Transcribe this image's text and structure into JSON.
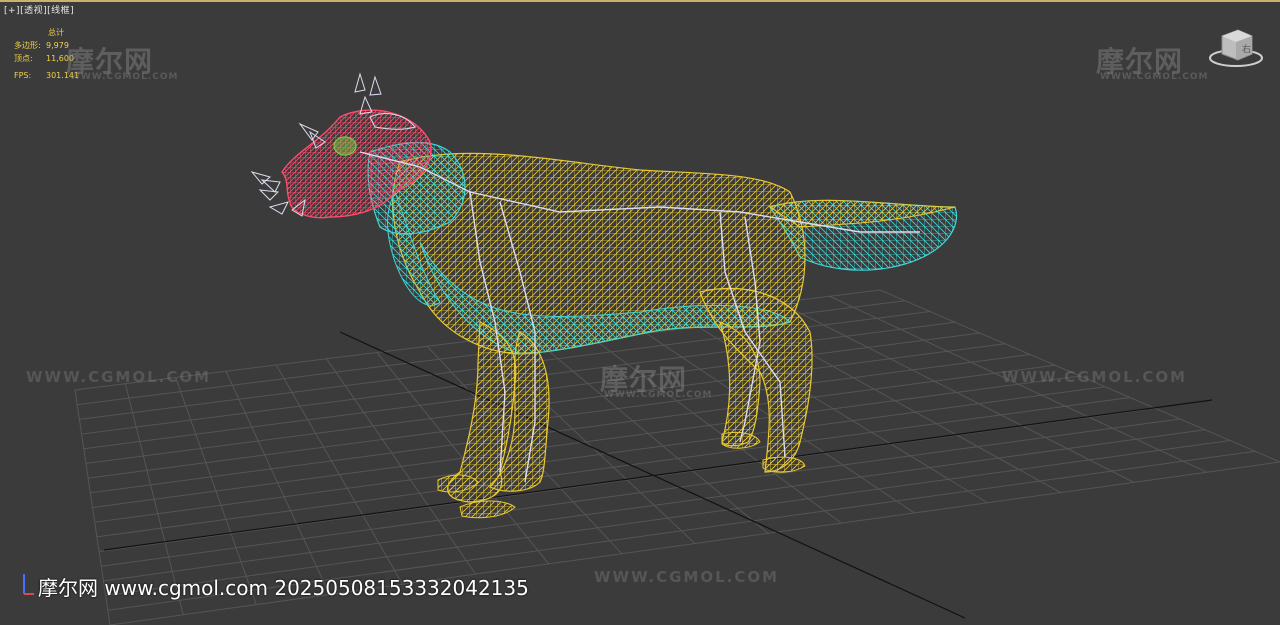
{
  "viewport": {
    "label_plus": "[+]",
    "label_view": "[透视]",
    "label_shading": "[线框]"
  },
  "stats": {
    "header": "总计",
    "polygons_label": "多边形:",
    "polygons_value": "9,979",
    "vertices_label": "顶点:",
    "vertices_value": "11,600",
    "fps_label": "FPS:",
    "fps_value": "301.141"
  },
  "watermarks": {
    "cn": "摩尔网",
    "url": "WWW.CGMOL.COM"
  },
  "footer": {
    "text": "摩尔网 www.cgmol.com 20250508153332042135"
  },
  "viewcube": {
    "face_label": "右"
  },
  "colors": {
    "background": "#3b3b3b",
    "grid": "#555555",
    "grid_axis": "#111111",
    "wire_yellow": "#e8c832",
    "wire_cyan": "#3fd6d6",
    "wire_red": "#ff4b6e",
    "wire_green": "#7ac943",
    "bones": "#dcdcf0",
    "stats_text": "#f0d24a",
    "border_active": "#c9b26a"
  }
}
